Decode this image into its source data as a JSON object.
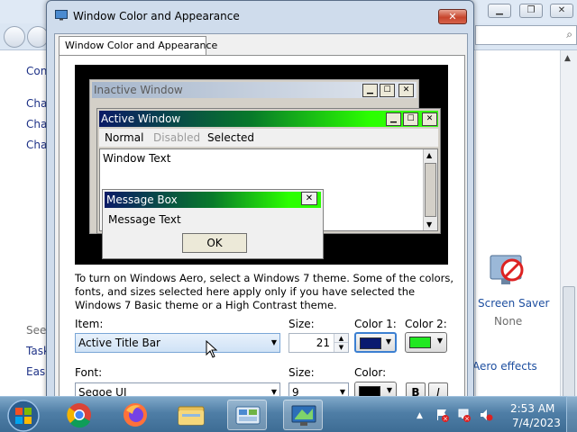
{
  "background_window": {
    "left_items": [
      "Con",
      "Cha",
      "Cha",
      "Cha"
    ],
    "see_also": "See",
    "task_items": [
      "Task",
      "Ease"
    ],
    "screen_saver_label": "Screen Saver",
    "screen_saver_value": "None",
    "aero_link": "Aero effects"
  },
  "dialog": {
    "title": "Window Color and Appearance",
    "close_label": "✕",
    "tab_label": "Window Color and Appearance",
    "preview": {
      "inactive_title": "Inactive Window",
      "active_title": "Active Window",
      "menu_normal": "Normal",
      "menu_disabled": "Disabled",
      "menu_selected": "Selected",
      "window_text": "Window Text",
      "message_box_title": "Message Box",
      "message_text": "Message Text",
      "ok_label": "OK",
      "minimize_glyph": "▁",
      "maximize_glyph": "☐",
      "close_glyph": "✕"
    },
    "info_text": "To turn on Windows Aero, select a Windows 7 theme.  Some of the colors, fonts, and sizes selected here apply only if you have selected the Windows 7 Basic theme or a High Contrast theme.",
    "item_label": "Item:",
    "item_value": "Active Title Bar",
    "size_label": "Size:",
    "size_value": "21",
    "color1_label": "Color 1:",
    "color1_value": "#0a1a70",
    "color2_label": "Color 2:",
    "color2_value": "#22e822",
    "font_label": "Font:",
    "font_value": "Segoe UI",
    "font_size_label": "Size:",
    "font_size_value": "9",
    "font_color_label": "Color:",
    "font_color_value": "#000000",
    "bold_label": "B",
    "italic_label": "I"
  },
  "taskbar": {
    "time": "2:53 AM",
    "date": "7/4/2023",
    "pinned": [
      "start-orb",
      "chrome-icon",
      "firefox-icon",
      "explorer-icon",
      "control-panel-icon",
      "display-settings-icon"
    ]
  },
  "colors": {
    "active_title_start": "#0a1a66",
    "active_title_end": "#39ff14",
    "taskbar": "#4f7ea6",
    "dialog_frame": "#cfdcec"
  }
}
